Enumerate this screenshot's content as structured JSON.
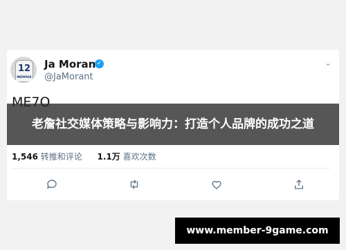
{
  "tweet": {
    "author_name": "Ja Morant",
    "handle": "@JaMorant",
    "avatar_number": "12",
    "avatar_team": "MEMPHIS",
    "text": "ME7O",
    "retweets": "1,546",
    "retweets_label": "转推和评论",
    "likes": "1.1万",
    "likes_label": "喜欢次数",
    "actions": [
      "reply-icon",
      "retweet-icon",
      "like-icon",
      "share-icon"
    ],
    "verified_color": "#1da1f2"
  },
  "banner": {
    "title": "老詹社交媒体策略与影响力：打造个人品牌的成功之道"
  },
  "watermark": {
    "text": "www.member-9game.com"
  }
}
